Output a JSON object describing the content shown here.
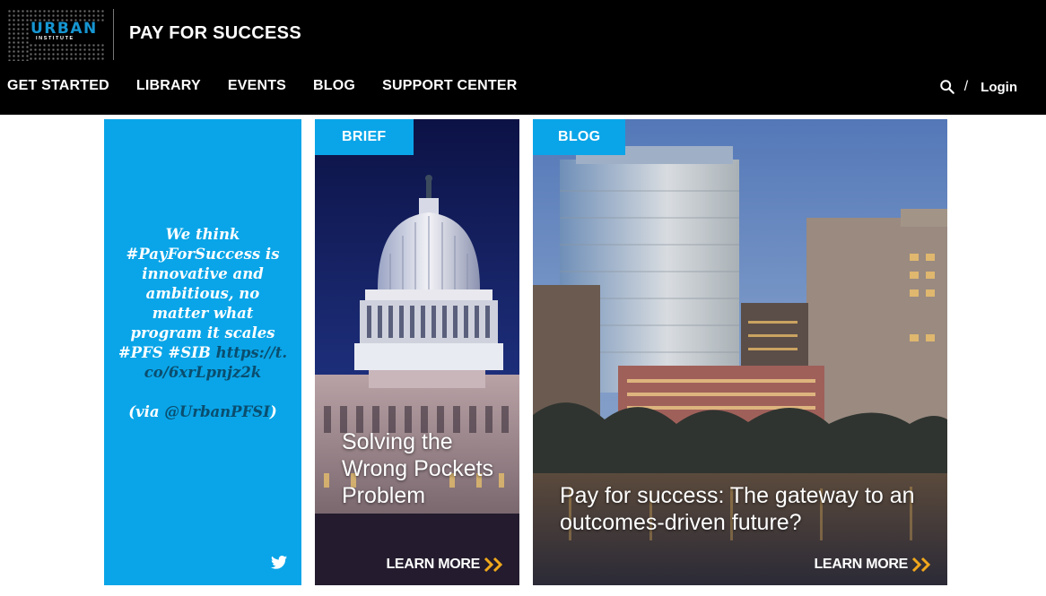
{
  "header": {
    "logo_word": "URBAN",
    "logo_sub": "INSTITUTE",
    "site_title": "PAY FOR SUCCESS",
    "nav": [
      "GET STARTED",
      "LIBRARY",
      "EVENTS",
      "BLOG",
      "SUPPORT CENTER"
    ],
    "separator": "/",
    "login_label": "Login"
  },
  "cards": {
    "twitter": {
      "tweet_text": "We think #PayForSuccess is innovative and ambitious, no matter what program it scales #PFS #SIB",
      "tweet_link": "https://t.co/6xrLpnjz2k",
      "tweet_via_open": "(via",
      "tweet_handle": "@UrbanPFSI",
      "tweet_via_close": ")",
      "icon": "twitter-icon"
    },
    "brief": {
      "tag": "BRIEF",
      "headline": "Solving the Wrong Pockets Problem",
      "cta": "LEARN MORE"
    },
    "blog": {
      "tag": "BLOG",
      "headline": "Pay for success: The gateway to an outcomes-driven future?",
      "cta": "LEARN MORE"
    }
  },
  "colors": {
    "header_bg": "#000000",
    "accent_blue": "#0aa5e8",
    "logo_blue": "#1696d2",
    "chevron_gold": "#f0a81c"
  }
}
